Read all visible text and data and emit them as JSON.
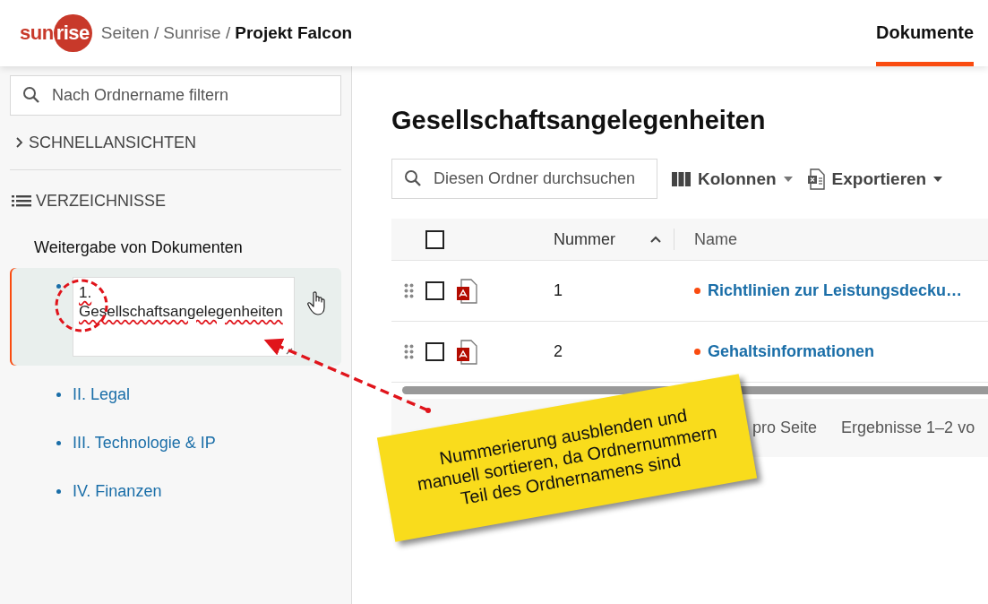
{
  "header": {
    "logo": {
      "part_1": "sun",
      "part_2": "rise"
    },
    "breadcrumb": [
      {
        "label": "Seiten /",
        "current": false
      },
      {
        "label": "Sunrise /",
        "current": false
      },
      {
        "label": "Projekt Falcon",
        "current": true
      }
    ],
    "tabs": [
      {
        "label": "Dokumente",
        "selected": true
      }
    ]
  },
  "sidebar": {
    "filter": {
      "placeholder": "Nach Ordnername filtern"
    },
    "quick_views": {
      "label": "SCHNELLANSICHTEN",
      "expanded": false
    },
    "directories": {
      "label": "VERZEICHNISSE"
    },
    "tree": {
      "label": "Weitergabe von Dokumenten",
      "children": [
        {
          "label": "1. Gesellschaftsangelegenheiten",
          "selected": true,
          "editing": true
        },
        {
          "label": "II. Legal",
          "selected": false,
          "editing": false
        },
        {
          "label": "III. Technologie & IP",
          "selected": false,
          "editing": false
        },
        {
          "label": "IV. Finanzen",
          "selected": false,
          "editing": false
        }
      ]
    }
  },
  "main": {
    "title": "Gesellschaftsangelegenheiten",
    "search": {
      "placeholder": "Diesen Ordner durchsuchen"
    },
    "toolbar": [
      {
        "label": "Kolonnen",
        "kind": "columns"
      },
      {
        "label": "Exportieren",
        "kind": "export"
      }
    ],
    "table": {
      "select_all": {
        "checked": false
      },
      "columns": [
        {
          "label": "Nummer",
          "sorted": true
        },
        {
          "label": "Name",
          "sorted": false
        }
      ],
      "rows": [
        {
          "number": "1",
          "name": "Richtlinien zur Leistungsdecku…",
          "checked": false
        },
        {
          "number": "2",
          "name": "Gehaltsinformationen",
          "checked": false
        }
      ]
    },
    "footer": [
      "pro Seite",
      "Ergebnisse 1–2 vo"
    ]
  },
  "annotation": {
    "lines": [
      "Nummerierung ausblenden und",
      "manuell sortieren, da Ordnernummern",
      "Teil des Ordnernamens sind"
    ]
  }
}
